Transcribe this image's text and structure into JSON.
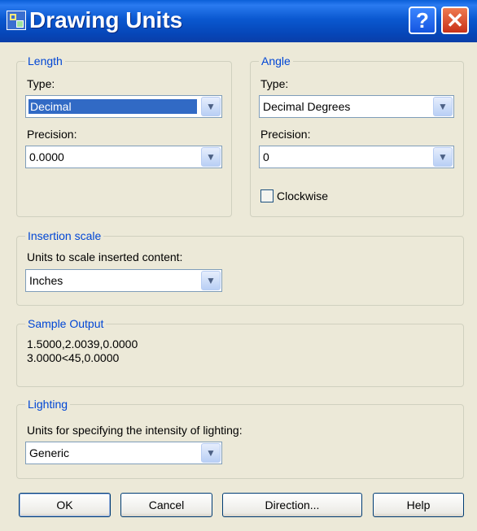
{
  "window": {
    "title": "Drawing Units",
    "help_glyph": "?",
    "close_glyph": "✕"
  },
  "length": {
    "legend": "Length",
    "type_label": "Type:",
    "type_value": "Decimal",
    "precision_label": "Precision:",
    "precision_value": "0.0000"
  },
  "angle": {
    "legend": "Angle",
    "type_label": "Type:",
    "type_value": "Decimal Degrees",
    "precision_label": "Precision:",
    "precision_value": "0",
    "clockwise_label": "Clockwise",
    "clockwise_checked": false
  },
  "insertion": {
    "legend": "Insertion scale",
    "label": "Units to scale inserted content:",
    "value": "Inches"
  },
  "sample": {
    "legend": "Sample Output",
    "line1": "1.5000,2.0039,0.0000",
    "line2": "3.0000<45,0.0000"
  },
  "lighting": {
    "legend": "Lighting",
    "label": "Units for specifying the intensity of lighting:",
    "value": "Generic"
  },
  "buttons": {
    "ok": "OK",
    "cancel": "Cancel",
    "direction": "Direction...",
    "help": "Help"
  },
  "icons": {
    "dropdown_arrow": "chevron-down-icon",
    "app_icon": "drawing-units-icon"
  },
  "colors": {
    "titlebar": "#0a58d0",
    "legend_text": "#0046d5",
    "selection": "#316ac5",
    "dialog_bg": "#ece9d8"
  }
}
